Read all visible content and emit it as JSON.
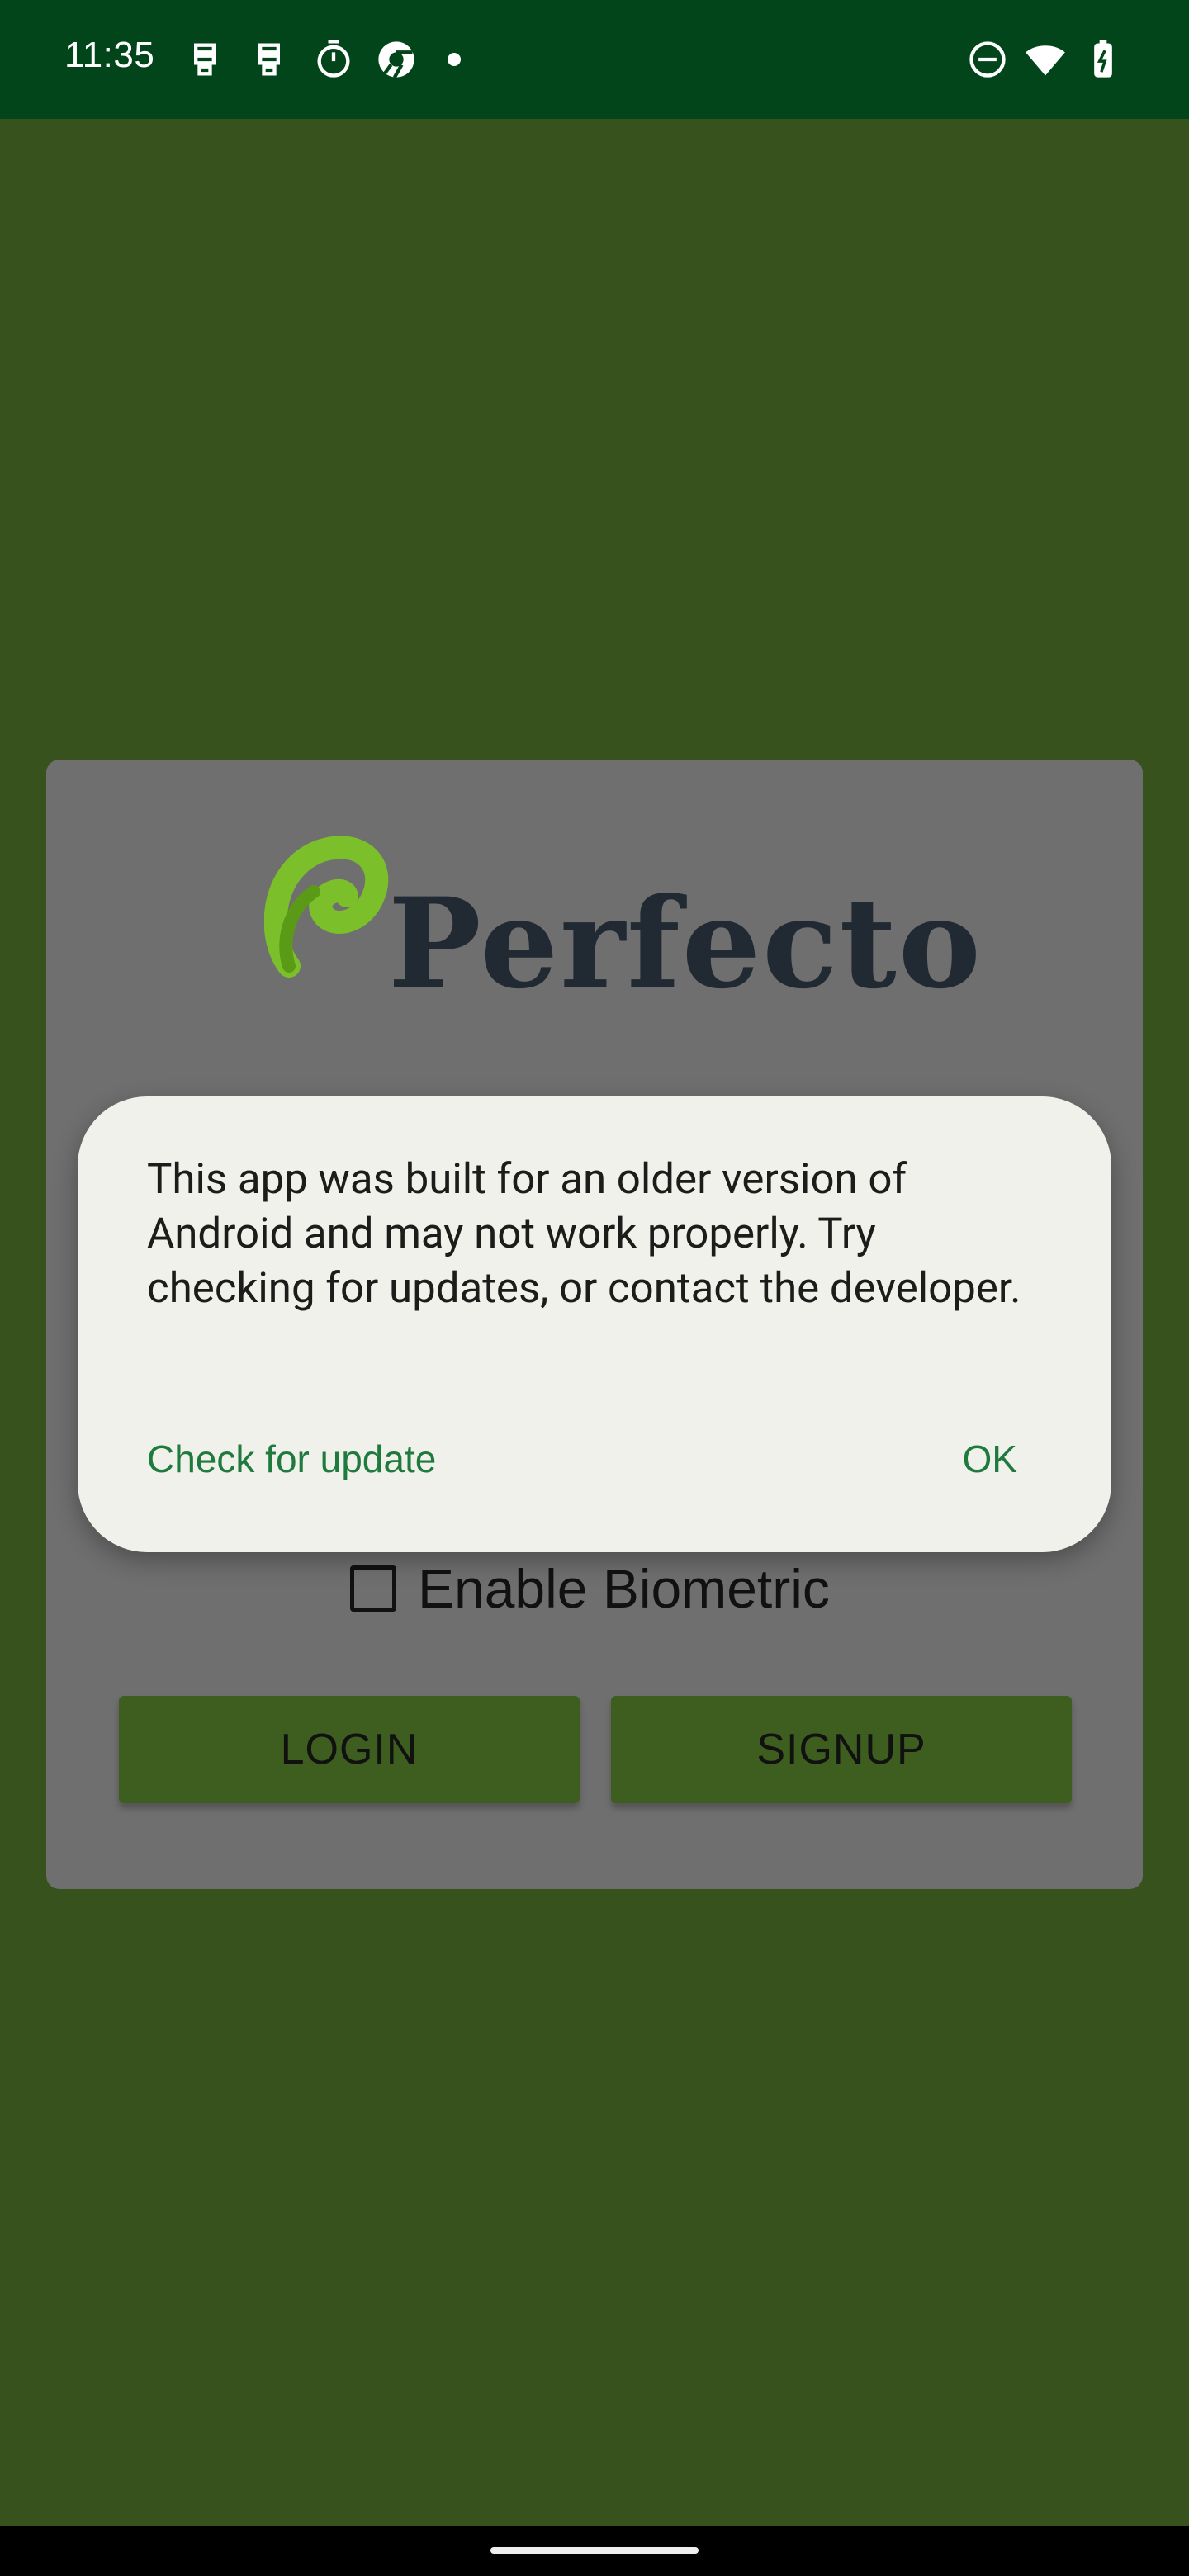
{
  "status_bar": {
    "time": "11:35",
    "left_icons": [
      "assistant-icon",
      "assistant-icon",
      "timer-icon",
      "chrome-icon",
      "dot-icon"
    ],
    "right_icons": [
      "do-not-disturb-icon",
      "wifi-icon",
      "battery-charging-icon"
    ]
  },
  "background_screen": {
    "logo_text": "Perfecto",
    "biometric_label": "Enable Biometric",
    "login_label": "LOGIN",
    "signup_label": "SIGNUP"
  },
  "dialog": {
    "message": "This app was built for an older version of Android and may not work properly. Try checking for updates, or contact the developer.",
    "check_update_label": "Check for update",
    "ok_label": "OK"
  },
  "colors": {
    "status_bar": "#03451a",
    "background": "#37521d",
    "card": "#6f6f6f",
    "dialog": "#f1f1ec",
    "dialog_button_text": "#1f7a3e"
  }
}
